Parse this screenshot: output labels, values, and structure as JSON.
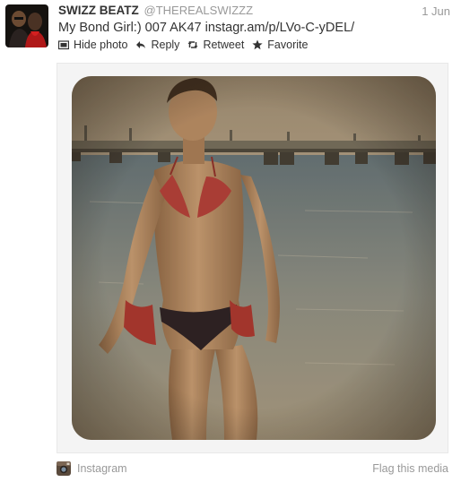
{
  "tweet": {
    "fullname": "SWIZZ BEATZ",
    "username": "@THEREALSWIZZZ",
    "time": "1 Jun",
    "text_prefix": "My Bond Girl:) 007 AK47 ",
    "link": "instagr.am/p/LVo-C-yDEL/",
    "actions": {
      "hide_photo": "Hide photo",
      "reply": "Reply",
      "retweet": "Retweet",
      "favorite": "Favorite"
    }
  },
  "media": {
    "source": "Instagram",
    "flag": "Flag this media"
  },
  "colors": {
    "text": "#333333",
    "muted": "#999999",
    "media_bg": "#f4f4f4"
  },
  "icons": {
    "hide_photo": "photo-icon",
    "reply": "reply-arrow-icon",
    "retweet": "retweet-icon",
    "favorite": "star-icon",
    "source": "instagram-icon"
  }
}
